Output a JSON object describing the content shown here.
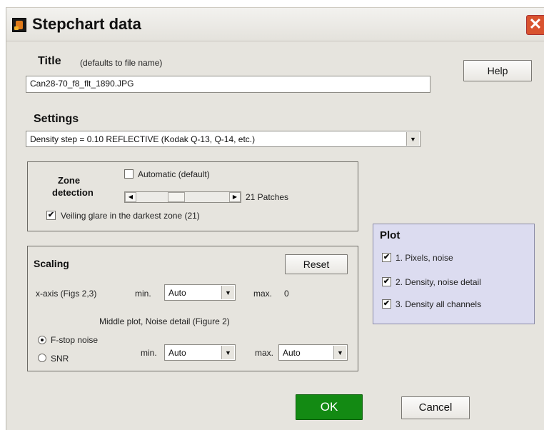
{
  "window": {
    "title": "Stepchart data",
    "close_glyph": "✕"
  },
  "title_section": {
    "heading": "Title",
    "hint": "(defaults to file name)",
    "value": "Can28-70_f8_flt_1890.JPG"
  },
  "help_label": "Help",
  "settings": {
    "heading": "Settings",
    "selected": "Density step = 0.10  REFLECTIVE       (Kodak Q-13, Q-14, etc.)"
  },
  "zone": {
    "heading_line1": "Zone",
    "heading_line2": "detection",
    "automatic_label": "Automatic (default)",
    "automatic_checked": false,
    "patches_label": "21 Patches",
    "veiling_label": "Veiling glare in the darkest zone (21)",
    "veiling_checked": true
  },
  "scaling": {
    "heading": "Scaling",
    "reset_label": "Reset",
    "xaxis_label": "x-axis (Figs 2,3)",
    "min_label": "min.",
    "xaxis_min_value": "Auto",
    "max_label": "max.",
    "xaxis_max_value": "0",
    "middle_plot_label": "Middle plot, Noise detail (Figure 2)",
    "fstop_label": "F-stop noise",
    "snr_label": "SNR",
    "selected_mode": "F-stop noise",
    "noise_min_value": "Auto",
    "noise_max_value": "Auto"
  },
  "plot": {
    "heading": "Plot",
    "background": "#dcdcf0",
    "items": [
      {
        "label": "1. Pixels, noise",
        "checked": true
      },
      {
        "label": "2. Density, noise detail",
        "checked": true
      },
      {
        "label": "3. Density all channels",
        "checked": true
      }
    ]
  },
  "ok_label": "OK",
  "ok_color": "#138a13",
  "cancel_label": "Cancel",
  "icons": {
    "check": "✔",
    "dropdown": "▼",
    "left_arrow": "◀",
    "right_arrow": "▶"
  }
}
